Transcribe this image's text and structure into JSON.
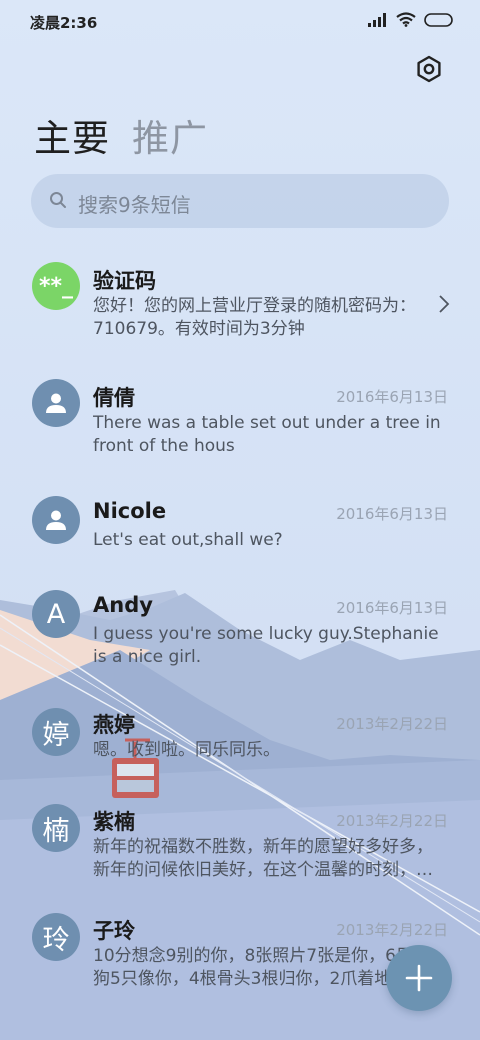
{
  "status_bar": {
    "time": "凌晨2:36"
  },
  "tabs": [
    {
      "label": "主要",
      "active": true
    },
    {
      "label": "推广",
      "active": false
    }
  ],
  "search": {
    "placeholder": "搜索9条短信"
  },
  "messages": [
    {
      "avatar": "**_",
      "name": "验证码",
      "date": "",
      "text": "您好！您的网上营业厅登录的随机密码为：710679。有效时间为3分钟"
    },
    {
      "avatar": "person-icon",
      "name": "倩倩",
      "date": "2016年6月13日",
      "text": "There was a table set out under a tree in front of the hous"
    },
    {
      "avatar": "person-icon",
      "name": "Nicole",
      "date": "2016年6月13日",
      "text": "Let's eat out,shall we?"
    },
    {
      "avatar": "A",
      "name": "Andy",
      "date": "2016年6月13日",
      "text": "I guess you're some lucky guy.Stephanie is a nice girl."
    },
    {
      "avatar": "婷",
      "name": "燕婷",
      "date": "2013年2月22日",
      "text": "嗯。收到啦。同乐同乐。"
    },
    {
      "avatar": "楠",
      "name": "紫楠",
      "date": "2013年2月22日",
      "text": "新年的祝福数不胜数，新年的愿望好多好多，新年的问候依旧美好，在这个温馨的时刻，…"
    },
    {
      "avatar": "玲",
      "name": "子玲",
      "date": "2013年2月22日",
      "text": "10分想念9别的你，8张照片7张是你，6只小狗5只像你，4根骨头3根归你，2爪着地"
    }
  ],
  "colors": {
    "avatar": "#6f8fb0",
    "avatar_code": "#7bd567",
    "fab": "#6c93b2"
  }
}
